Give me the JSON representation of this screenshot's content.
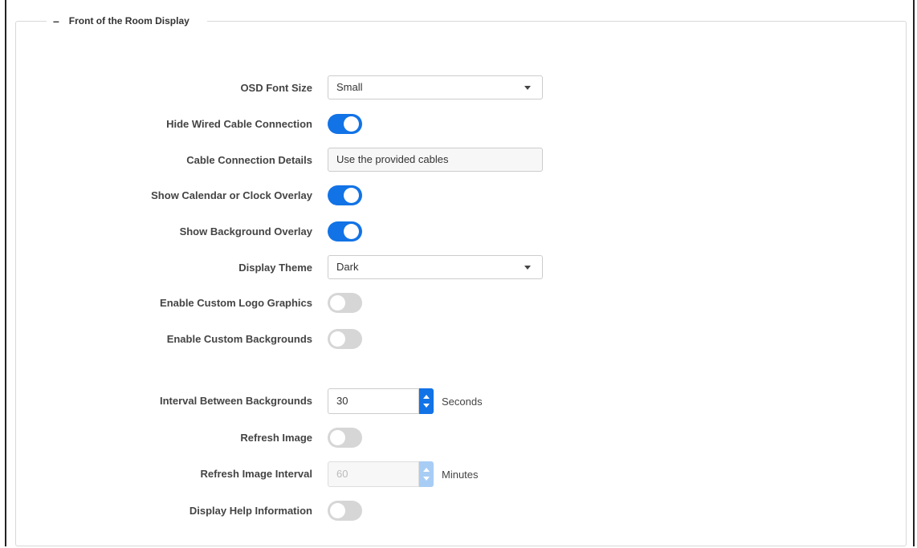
{
  "section": {
    "collapse_symbol": "–",
    "title": "Front of the Room Display"
  },
  "fields": {
    "osd_font_size": {
      "label": "OSD Font Size",
      "value": "Small"
    },
    "hide_wired_cable": {
      "label": "Hide Wired Cable Connection",
      "state": "on"
    },
    "cable_details": {
      "label": "Cable Connection Details",
      "value": "Use the provided cables"
    },
    "calendar_overlay": {
      "label": "Show Calendar or Clock Overlay",
      "state": "on"
    },
    "background_overlay": {
      "label": "Show Background Overlay",
      "state": "on"
    },
    "display_theme": {
      "label": "Display Theme",
      "value": "Dark"
    },
    "custom_logo": {
      "label": "Enable Custom Logo Graphics",
      "state": "off"
    },
    "custom_backgrounds": {
      "label": "Enable Custom Backgrounds",
      "state": "off"
    },
    "interval_backgrounds": {
      "label": "Interval Between Backgrounds",
      "value": "30",
      "unit": "Seconds"
    },
    "refresh_image": {
      "label": "Refresh Image",
      "state": "off"
    },
    "refresh_interval": {
      "label": "Refresh Image Interval",
      "value": "60",
      "unit": "Minutes",
      "disabled": true
    },
    "display_help": {
      "label": "Display Help Information",
      "state": "off"
    }
  },
  "colors": {
    "accent": "#1273e6",
    "toggle_off": "#d6d6d6",
    "disabled_accent": "#a8cdf5"
  }
}
